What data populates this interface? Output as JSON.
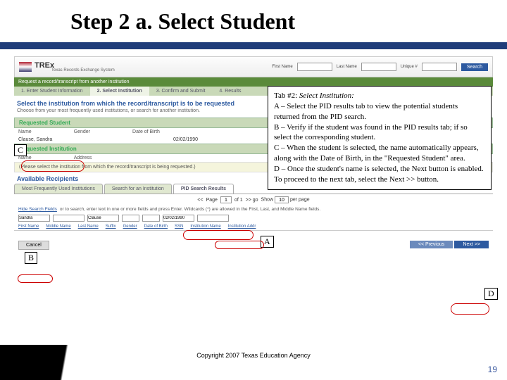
{
  "title": "Step 2 a. Select Student",
  "header": {
    "logo": "TREx",
    "logo_sub": "Texas Records Exchange System",
    "first_label": "First Name",
    "last_label": "Last Name",
    "unique_label": "Unique #",
    "search_btn": "Search"
  },
  "greenbar": "Request a record/transcript from another institution",
  "steps": {
    "s1": "1. Enter Student Information",
    "s2": "2. Select Institution",
    "s3": "3. Confirm and Submit",
    "s4": "4. Results"
  },
  "instr": "Select the institution from which the record/transcript is to be requested",
  "sub": "Choose from your most frequently used institutions, or search for another institution.",
  "req_student_h": "Requested Student",
  "row_labels": {
    "name": "Name",
    "gender": "Gender",
    "dob": "Date of Birth"
  },
  "student": {
    "name": "Clause, Sandra",
    "gender": "",
    "dob": "02/02/1990"
  },
  "req_inst_h": "Requested Institution",
  "inst_row": {
    "name": "Name",
    "addr": "Address"
  },
  "please": "(Please select the institution from which the record/transcript is being requested.)",
  "avail_h": "Available Recipients",
  "tabs": {
    "t1": "Most Frequently Used Institutions",
    "t2": "Search for an Institution",
    "t3": "PID Search Results"
  },
  "pager": {
    "prev": "<<",
    "page_lbl": "Page",
    "page_val": "1",
    "of": "of 1",
    "next": ">>",
    "go": ">> go",
    "show": "Show",
    "show_val": "10",
    "per": "per page"
  },
  "hide_row": {
    "hide": "Hide Search Fields",
    "or": "or to search, enter text in one or more fields and press Enter. Wildcards (*) are allowed in the First, Last, and Middle Name fields.",
    "first_val": "Sandra",
    "last_val": "Clause",
    "dob_val": "02/02/1990"
  },
  "grid": {
    "c1": "First Name",
    "c2": "Middle Name",
    "c3": "Last Name",
    "c4": "Suffix",
    "c5": "Gender",
    "c6": "Date of Birth",
    "c7": "SSN",
    "c8": "Institution Name",
    "c9": "Institution Addr"
  },
  "buttons": {
    "cancel": "Cancel",
    "prev": "<< Previous",
    "next": "Next >>"
  },
  "callout": {
    "l1": "Tab #2: ",
    "l1b": "Select Institution:",
    "l2": "A – Select the PID results tab to view the potential students returned from the PID search.",
    "l3": "B – Verify if the student was found in the PID results tab; if so select the corresponding student.",
    "l4": "C – When the student is selected, the name automatically appears, along with the Date of Birth, in the \"Requested Student\" area.",
    "l5": "D – Once the student's name is selected, the Next button is enabled.  To proceed to the next tab, select the Next >> button."
  },
  "labels": {
    "A": "A",
    "B": "B",
    "C": "C",
    "D": "D"
  },
  "copyright": "Copyright 2007  Texas Education Agency",
  "pagenum": "19"
}
